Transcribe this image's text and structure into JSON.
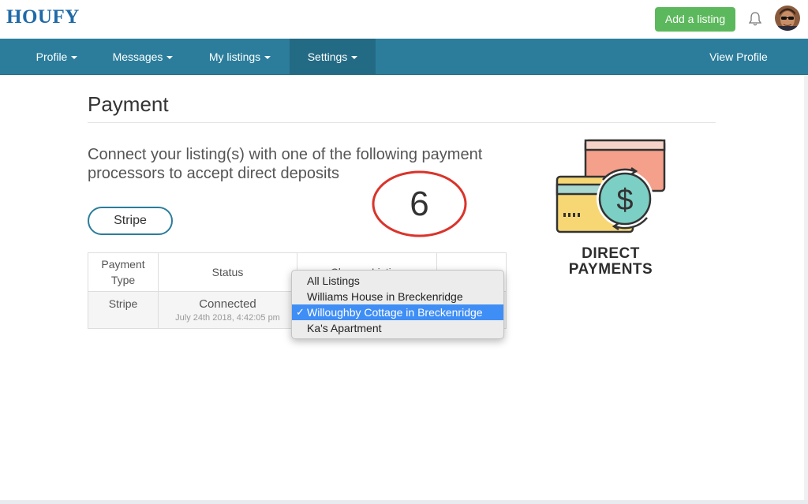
{
  "header": {
    "logo": "HOUFY",
    "add_listing_label": "Add a listing"
  },
  "nav": {
    "items": [
      {
        "label": "Profile"
      },
      {
        "label": "Messages"
      },
      {
        "label": "My listings"
      },
      {
        "label": "Settings"
      }
    ],
    "active": "Settings",
    "view_profile_label": "View Profile"
  },
  "main": {
    "title": "Payment",
    "intro": "Connect your listing(s) with one of the following payment processors to accept direct deposits",
    "stripe_button_label": "Stripe",
    "annotation_number": "6"
  },
  "table": {
    "headers": [
      "Payment Type",
      "Status",
      "Choose Listing",
      ""
    ],
    "rows": [
      {
        "type": "Stripe",
        "status": "Connected",
        "status_date": "July 24th 2018, 4:42:05 pm"
      }
    ]
  },
  "dropdown": {
    "options": [
      "All Listings",
      "Williams House in Breckenridge",
      "Willoughby Cottage in Breckenridge",
      "Ka's Apartment"
    ],
    "selected": "Willoughby Cottage in Breckenridge"
  },
  "illustration": {
    "label_line1": "DIRECT",
    "label_line2": "PAYMENTS"
  },
  "colors": {
    "brand_blue": "#1f6aa8",
    "nav_teal": "#2b7d9b",
    "add_green": "#5cb85c",
    "select_blue": "#3f8ef5",
    "annotation_red": "#d9342b"
  }
}
